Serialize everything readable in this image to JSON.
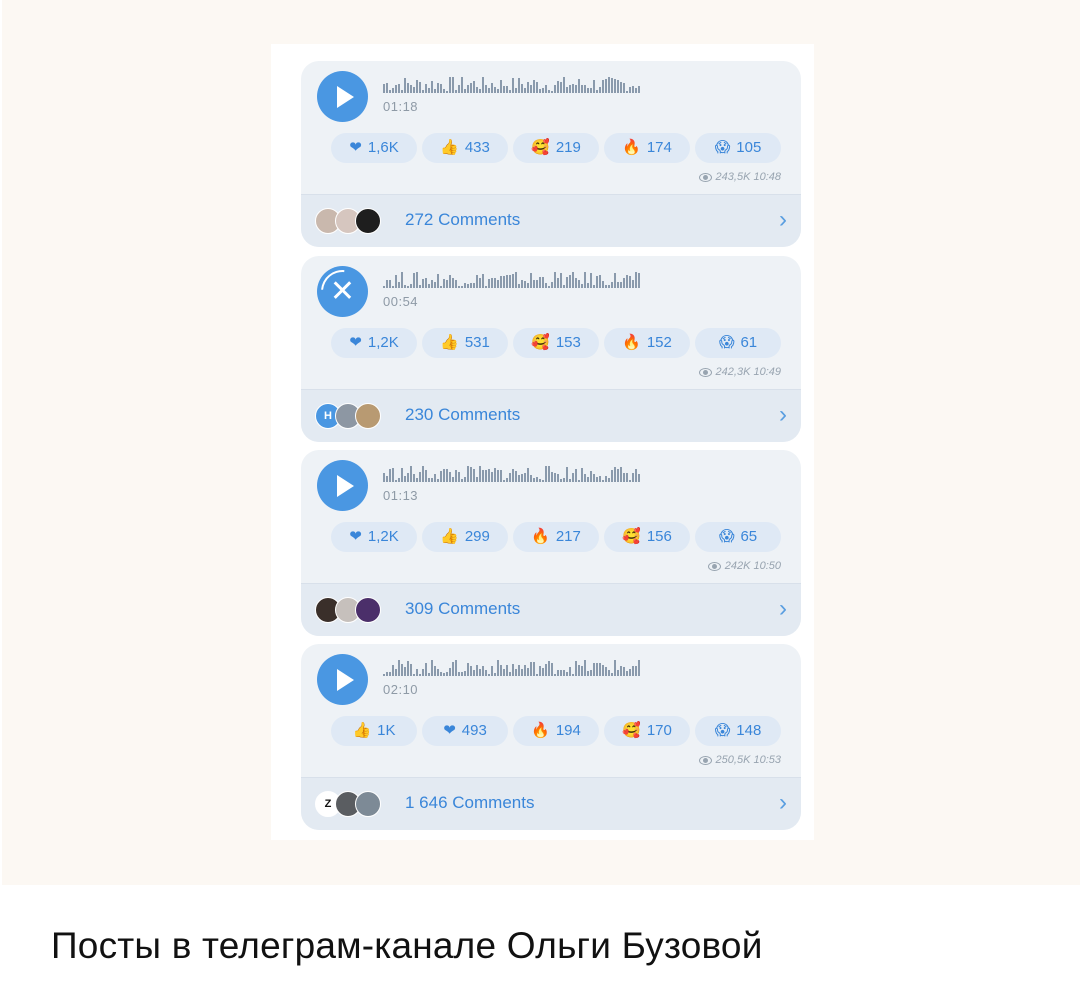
{
  "caption": "Посты в телеграм-канале Ольги Бузовой",
  "posts": [
    {
      "icon": "play",
      "duration": "01:18",
      "reactions": [
        {
          "icon": "heart-icon",
          "glyph": "❤",
          "count": "1,6K"
        },
        {
          "icon": "thumbs-up-icon",
          "glyph": "👍",
          "count": "433"
        },
        {
          "icon": "hearts-face-icon",
          "glyph": "🥰",
          "count": "219"
        },
        {
          "icon": "fire-icon",
          "glyph": "🔥",
          "count": "174"
        },
        {
          "icon": "scream-face-icon",
          "glyph": "😱",
          "count": "105"
        }
      ],
      "views": "243,5K 10:48",
      "comments": "272 Comments",
      "avatars": [
        "#c9b8ad",
        "#d6c6bf",
        "#1e1e1e"
      ],
      "avatar_letters": [
        "",
        "",
        ""
      ]
    },
    {
      "icon": "cancel",
      "duration": "00:54",
      "reactions": [
        {
          "icon": "heart-icon",
          "glyph": "❤",
          "count": "1,2K"
        },
        {
          "icon": "thumbs-up-icon",
          "glyph": "👍",
          "count": "531"
        },
        {
          "icon": "hearts-face-icon",
          "glyph": "🥰",
          "count": "153"
        },
        {
          "icon": "fire-icon",
          "glyph": "🔥",
          "count": "152"
        },
        {
          "icon": "scream-face-icon",
          "glyph": "😱",
          "count": "61"
        }
      ],
      "views": "242,3K 10:49",
      "comments": "230 Comments",
      "avatars": [
        "#4a97e2",
        "#8d97a3",
        "#b89a72"
      ],
      "avatar_letters": [
        "H",
        "",
        ""
      ]
    },
    {
      "icon": "play",
      "duration": "01:13",
      "reactions": [
        {
          "icon": "heart-icon",
          "glyph": "❤",
          "count": "1,2K"
        },
        {
          "icon": "thumbs-up-icon",
          "glyph": "👍",
          "count": "299"
        },
        {
          "icon": "fire-icon",
          "glyph": "🔥",
          "count": "217"
        },
        {
          "icon": "hearts-face-icon",
          "glyph": "🥰",
          "count": "156"
        },
        {
          "icon": "scream-face-icon",
          "glyph": "😱",
          "count": "65"
        }
      ],
      "views": "242K 10:50",
      "comments": "309 Comments",
      "avatars": [
        "#3a2f2a",
        "#c6c0bc",
        "#4b2f6a"
      ],
      "avatar_letters": [
        "",
        "",
        ""
      ]
    },
    {
      "icon": "play",
      "duration": "02:10",
      "reactions": [
        {
          "icon": "thumbs-up-icon",
          "glyph": "👍",
          "count": "1K"
        },
        {
          "icon": "heart-icon",
          "glyph": "❤",
          "count": "493"
        },
        {
          "icon": "fire-icon",
          "glyph": "🔥",
          "count": "194"
        },
        {
          "icon": "hearts-face-icon",
          "glyph": "🥰",
          "count": "170"
        },
        {
          "icon": "scream-face-icon",
          "glyph": "😱",
          "count": "148"
        }
      ],
      "views": "250,5K 10:53",
      "comments": "1 646 Comments",
      "avatars": [
        "#ffffff",
        "#5a5d61",
        "#7d8a96"
      ],
      "avatar_letters": [
        "Z",
        "",
        ""
      ]
    }
  ],
  "colors": {
    "accent": "#3a86d9",
    "play_button": "#4a97e2",
    "bubble": "#eef2f6",
    "chip": "#dfe9f5"
  }
}
